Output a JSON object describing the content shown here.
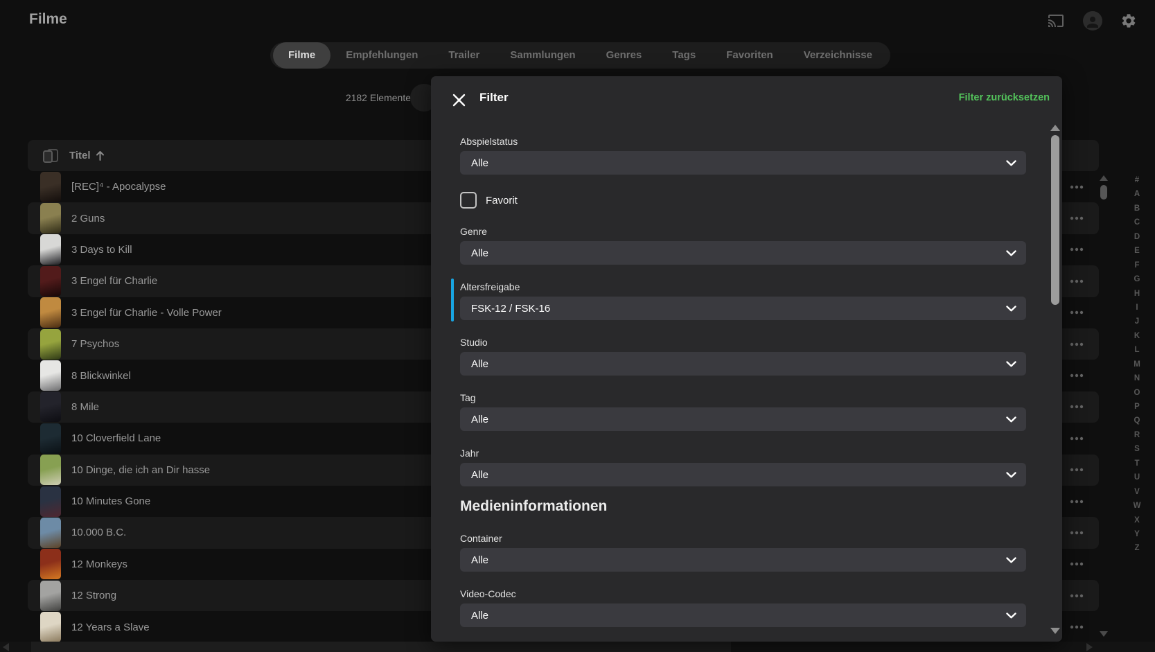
{
  "header": {
    "title": "Filme"
  },
  "icons": {
    "cast-icon": "cast-frame-with-waves",
    "user-avatar-icon": "person-silhouette",
    "settings-gear-icon": "gear",
    "close-icon": "x",
    "sort-ascending-icon": "arrow-up",
    "poster-column-icon": "stacked-posters",
    "row-menu-icon": "ellipsis-dots",
    "select-chevron-icon": "chevron-down",
    "scroll-up-icon": "triangle-up",
    "scroll-down-icon": "triangle-down",
    "scroll-left-icon": "triangle-left",
    "scroll-right-icon": "triangle-right"
  },
  "colors": {
    "accent_blue": "#18a5e2",
    "reset_green": "#53c25b",
    "dialog_bg": "#29292b",
    "select_bg": "#3a3a3f",
    "page_bg": "#0f0f0f"
  },
  "tabs": {
    "items": [
      {
        "label": "Filme",
        "active": true
      },
      {
        "label": "Empfehlungen",
        "active": false
      },
      {
        "label": "Trailer",
        "active": false
      },
      {
        "label": "Sammlungen",
        "active": false
      },
      {
        "label": "Genres",
        "active": false
      },
      {
        "label": "Tags",
        "active": false
      },
      {
        "label": "Favoriten",
        "active": false
      },
      {
        "label": "Verzeichnisse",
        "active": false
      }
    ]
  },
  "toolbar": {
    "items_count": "2182 Elemente"
  },
  "library": {
    "column_label": "Titel",
    "sort_direction": "ascending",
    "rows": [
      {
        "title": "[REC]⁴ - Apocalypse",
        "poster": [
          "#3a2f26",
          "#120d0b"
        ]
      },
      {
        "title": "2 Guns",
        "poster": [
          "#8a8050",
          "#2e2a16"
        ]
      },
      {
        "title": "3 Days to Kill",
        "poster": [
          "#d8d8d6",
          "#1e1e22"
        ]
      },
      {
        "title": "3 Engel für Charlie",
        "poster": [
          "#521b1b",
          "#160707"
        ]
      },
      {
        "title": "3 Engel für Charlie - Volle Power",
        "poster": [
          "#c08a40",
          "#4a2c12"
        ]
      },
      {
        "title": "7 Psychos",
        "poster": [
          "#96a43e",
          "#2f3a16"
        ]
      },
      {
        "title": "8 Blickwinkel",
        "poster": [
          "#e6e6e4",
          "#6e6e70"
        ]
      },
      {
        "title": "8 Mile",
        "poster": [
          "#23232b",
          "#0d0d12"
        ]
      },
      {
        "title": "10 Cloverfield Lane",
        "poster": [
          "#1d2b33",
          "#0a1014"
        ]
      },
      {
        "title": "10 Dinge, die ich an Dir hasse",
        "poster": [
          "#87a052",
          "#cfcdb4"
        ]
      },
      {
        "title": "10 Minutes Gone",
        "poster": [
          "#2a3242",
          "#4f2730"
        ]
      },
      {
        "title": "10.000 B.C.",
        "poster": [
          "#6d8ba6",
          "#5d4326"
        ]
      },
      {
        "title": "12 Monkeys",
        "poster": [
          "#8c2f1a",
          "#d57a22"
        ]
      },
      {
        "title": "12 Strong",
        "poster": [
          "#a3a3a1",
          "#41413f"
        ]
      },
      {
        "title": "12 Years a Slave",
        "poster": [
          "#ded6c4",
          "#8a795c"
        ]
      }
    ]
  },
  "alphabet": [
    "#",
    "A",
    "B",
    "C",
    "D",
    "E",
    "F",
    "G",
    "H",
    "I",
    "J",
    "K",
    "L",
    "M",
    "N",
    "O",
    "P",
    "Q",
    "R",
    "S",
    "T",
    "U",
    "V",
    "W",
    "X",
    "Y",
    "Z"
  ],
  "filter_dialog": {
    "title": "Filter",
    "reset_label": "Filter zurücksetzen",
    "fields": [
      {
        "type": "select",
        "label": "Abspielstatus",
        "value": "Alle"
      },
      {
        "type": "checkbox",
        "label": "Favorit",
        "checked": false
      },
      {
        "type": "select",
        "label": "Genre",
        "value": "Alle"
      },
      {
        "type": "select",
        "label": "Altersfreigabe",
        "value": "FSK-12 / FSK-16",
        "highlighted": true
      },
      {
        "type": "select",
        "label": "Studio",
        "value": "Alle"
      },
      {
        "type": "select",
        "label": "Tag",
        "value": "Alle"
      },
      {
        "type": "select",
        "label": "Jahr",
        "value": "Alle"
      },
      {
        "type": "heading",
        "label": "Medieninformationen"
      },
      {
        "type": "select",
        "label": "Container",
        "value": "Alle"
      },
      {
        "type": "select",
        "label": "Video-Codec",
        "value": "Alle"
      }
    ]
  }
}
